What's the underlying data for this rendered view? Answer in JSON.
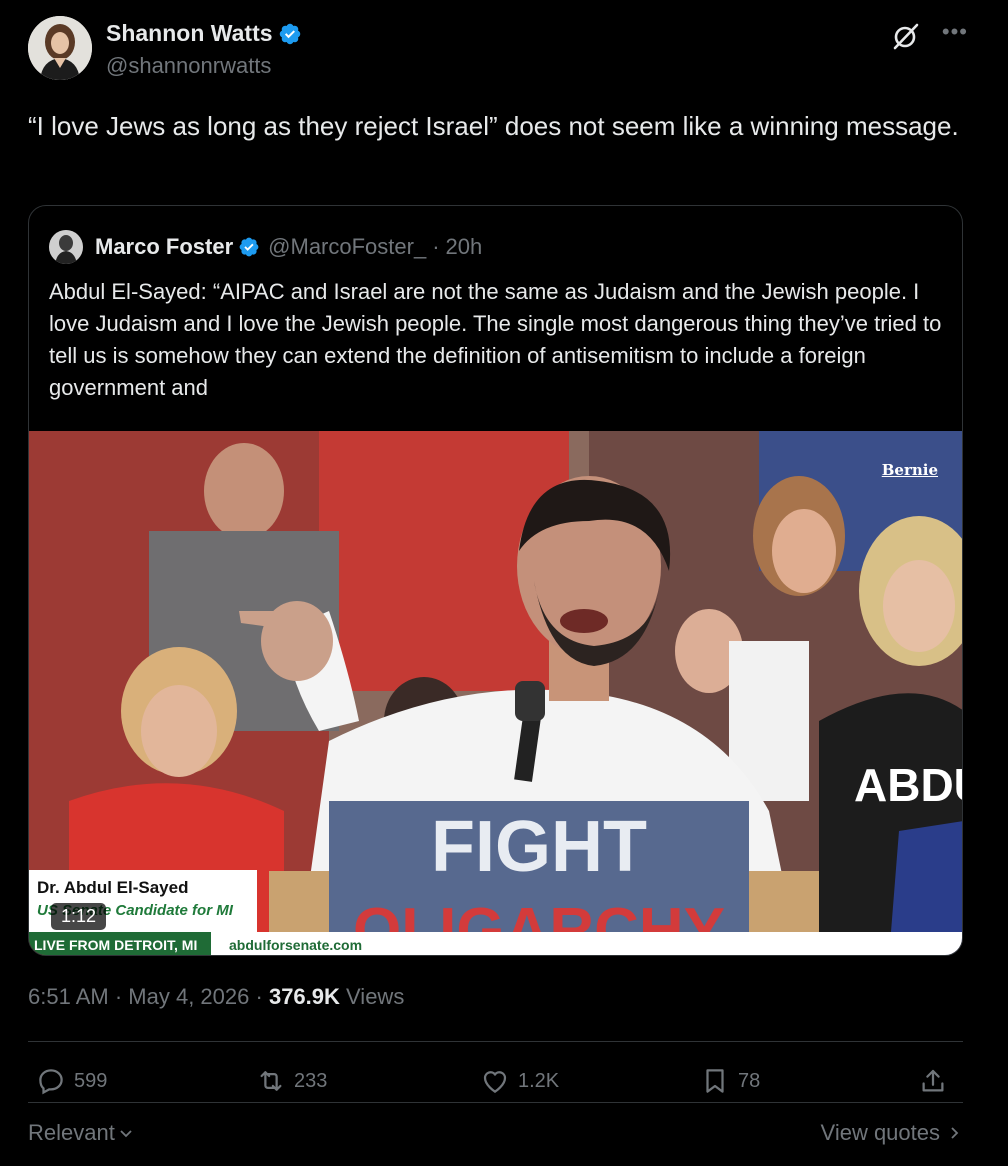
{
  "author": {
    "display_name": "Shannon Watts",
    "handle": "@shannonrwatts"
  },
  "tweet": {
    "text": "“I love Jews as long as they reject Israel” does not seem like a winning message."
  },
  "quoted": {
    "display_name": "Marco Foster",
    "handle": "@MarcoFoster_",
    "separator": "·",
    "age": "20h",
    "text": "Abdul El-Sayed: “AIPAC and Israel are not the same as Judaism and the Jewish people. I love Judaism and I love the Jewish people. The single most dangerous thing they’ve tried to tell us is somehow they can extend the definition of antisemitism to include a foreign government and",
    "video": {
      "duration": "1:12",
      "lower_third_name": "Dr. Abdul El-Sayed",
      "lower_third_title": "US Senate Candidate for MI",
      "ticker_left": "LIVE FROM DETROIT, MI",
      "ticker_right": "abdulforsenate.com",
      "watermark": "Bernie",
      "podium_text": "FIGHT",
      "podium_text_2": "OLIGARCHY"
    }
  },
  "meta": {
    "time": "6:51 AM",
    "date": "May 4, 2026",
    "views_count": "376.9K",
    "views_label": "Views"
  },
  "actions": {
    "replies": "599",
    "reposts": "233",
    "likes": "1.2K",
    "bookmarks": "78"
  },
  "footer": {
    "sort_label": "Relevant",
    "view_quotes": "View quotes"
  },
  "colors": {
    "background": "#000000",
    "text": "#e7e9ea",
    "muted": "#71767b",
    "verified": "#1d9bf0",
    "border": "#2f3336"
  }
}
